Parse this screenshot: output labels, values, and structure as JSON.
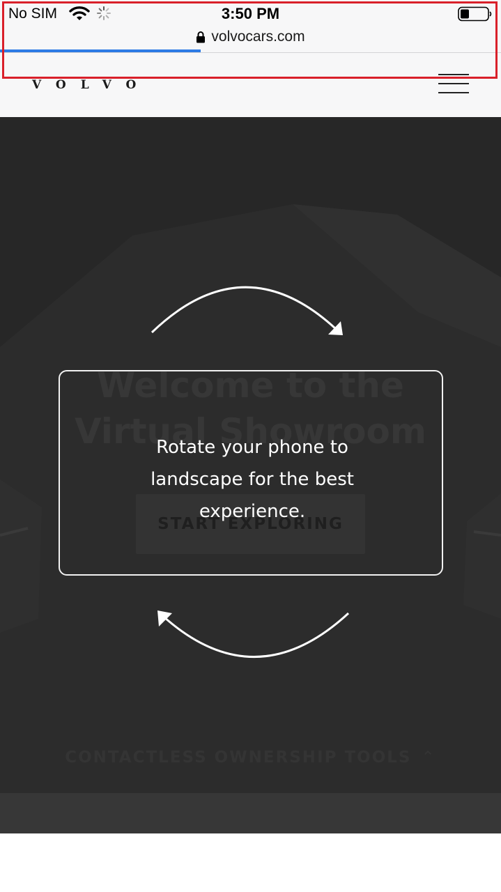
{
  "status_bar": {
    "carrier": "No SIM",
    "time": "3:50 PM",
    "url": "volvocars.com",
    "page_load_progress_fraction": 0.4
  },
  "header": {
    "logo_text": "VOLVO",
    "menu_icon": "hamburger-menu-icon"
  },
  "hero": {
    "title_line1": "Welcome to the",
    "title_line2": "Virtual Showroom",
    "start_button_label": "START EXPLORING",
    "tools_link_label": "CONTACTLESS OWNERSHIP TOOLS",
    "tools_link_icon": "chevron-up-icon"
  },
  "overlay": {
    "message_line1": "Rotate your phone to",
    "message_line2": "landscape for the best",
    "message_line3": "experience.",
    "arrow_icons": [
      "rotate-clockwise-arrow-icon",
      "rotate-counterclockwise-arrow-icon"
    ]
  },
  "annotation": {
    "highlight_color": "#d9202a"
  },
  "colors": {
    "progress_bar": "#2d7be5",
    "overlay_dim": "#272727",
    "overlay_text": "#ffffff"
  }
}
